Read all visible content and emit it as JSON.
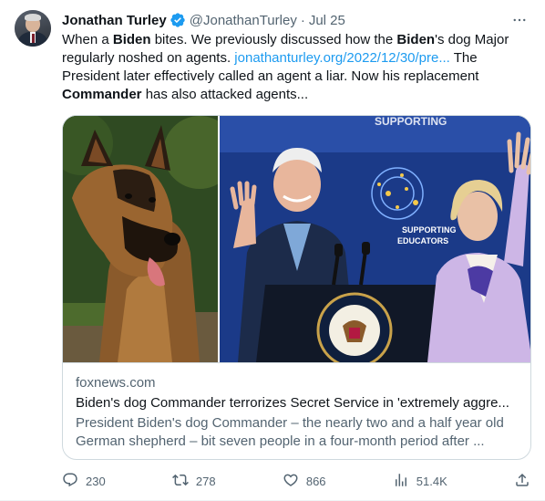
{
  "tweet": {
    "author_name": "Jonathan Turley",
    "handle": "@JonathanTurley",
    "separator": "·",
    "date": "Jul 25",
    "more_label": "···",
    "text": {
      "t1": "When a ",
      "b1": "Biden",
      "t2": " bites. We previously discussed how the ",
      "b2": "Biden",
      "t3": "'s dog Major regularly noshed on agents. ",
      "link": "jonathanturley.org/2022/12/30/pre...",
      "t4": " The President later effectively called an agent a liar.  Now his replacement ",
      "b3": "Commander",
      "t5": " has also attacked agents..."
    }
  },
  "card": {
    "domain": "foxnews.com",
    "title": "Biden's dog Commander terrorizes Secret Service in 'extremely aggre...",
    "description": "President Biden's dog Commander – the nearly two and a half year old German shepherd – bit seven people in a four-month period after ...",
    "photo_right_banner_top": "SUPPORTING",
    "photo_right_banner_1": "SUPPORTING",
    "photo_right_banner_2": "EDUCATORS"
  },
  "actions": {
    "replies": "230",
    "retweets": "278",
    "likes": "866",
    "views": "51.4K"
  },
  "colors": {
    "accent": "#1d9bf0",
    "text": "#0f1419",
    "muted": "#536471",
    "border": "#cfd9de"
  },
  "icons": [
    "verified-badge-icon",
    "more-icon",
    "reply-icon",
    "retweet-icon",
    "like-icon",
    "views-icon",
    "share-icon"
  ]
}
